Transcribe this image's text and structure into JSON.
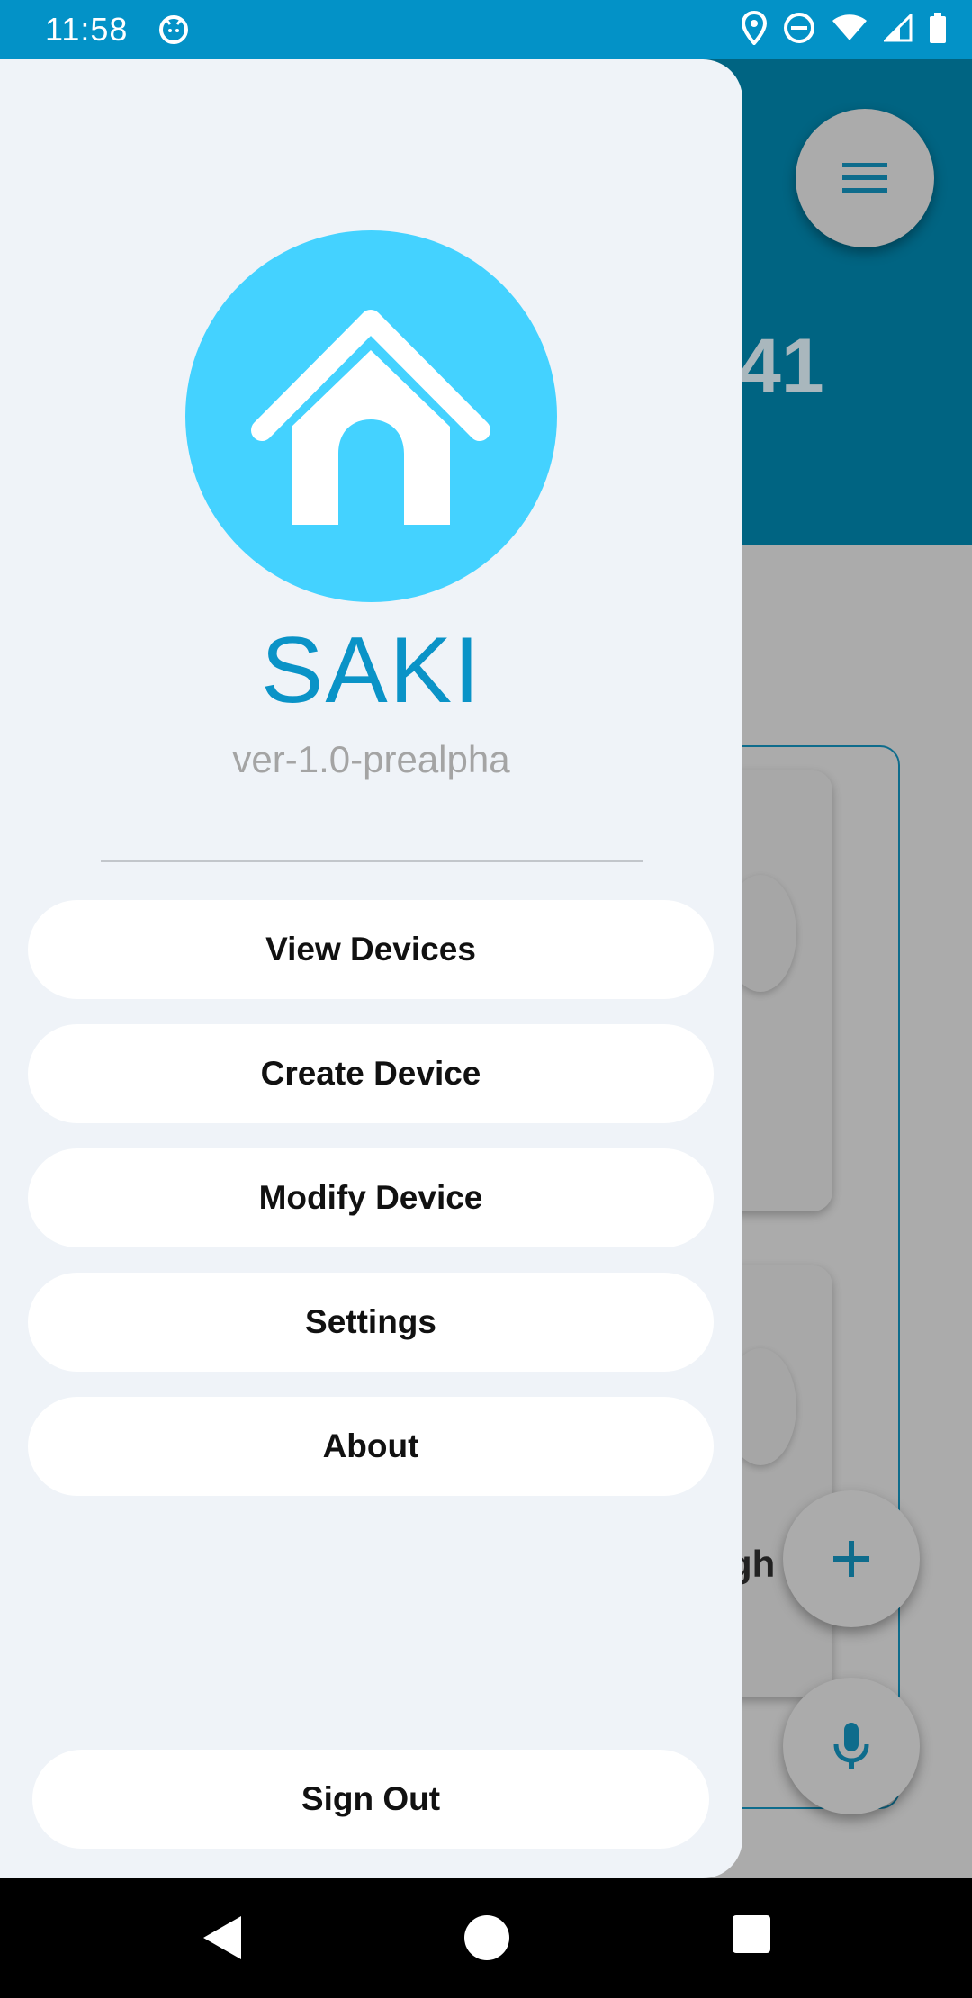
{
  "status_bar": {
    "time": "11:58",
    "icons": [
      "app-notification-icon",
      "location-icon",
      "do-not-disturb-icon",
      "wifi-icon",
      "signal-icon",
      "battery-icon"
    ]
  },
  "background_app": {
    "big_number": "41",
    "card_text": "gh",
    "card_sub": ")",
    "icons": [
      "menu-icon",
      "plus-icon",
      "microphone-icon"
    ]
  },
  "drawer": {
    "app_name": "SAKI",
    "version": "ver-1.0-prealpha",
    "menu_items": [
      {
        "label": "View Devices"
      },
      {
        "label": "Create Device"
      },
      {
        "label": "Modify Device"
      },
      {
        "label": "Settings"
      },
      {
        "label": "About"
      }
    ],
    "sign_out": "Sign Out"
  },
  "colors": {
    "status_bar": "#0392c7",
    "brand": "#0a93c7",
    "logo_bg": "#44d2ff",
    "drawer_bg": "#eff3f8",
    "header_dimmed": "#006482"
  },
  "nav_bar": {
    "icons": [
      "back-icon",
      "home-icon",
      "recents-icon"
    ]
  }
}
